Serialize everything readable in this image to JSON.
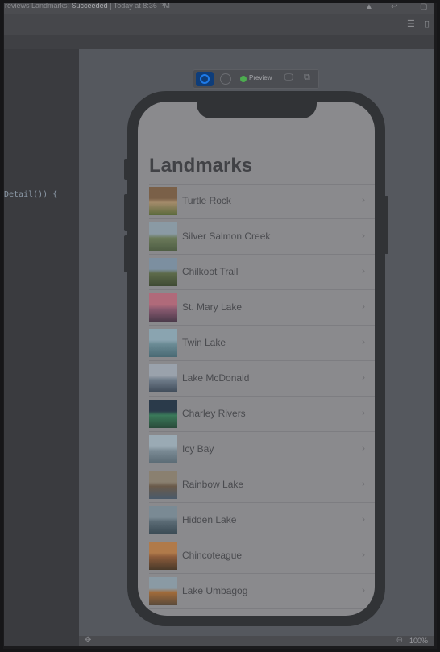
{
  "window": {
    "status_prefix": "reviews Landmarks:",
    "status_result": "Succeeded",
    "status_time": "| Today at 8:36 PM"
  },
  "editor": {
    "code_line": "Detail()) {"
  },
  "preview_toolbar": {
    "preview_label": "Preview"
  },
  "app": {
    "title": "Landmarks",
    "landmarks": [
      {
        "name": "Turtle Rock",
        "colors": [
          "#7a6048",
          "#a38a6a",
          "#5b6a3c"
        ]
      },
      {
        "name": "Silver Salmon Creek",
        "colors": [
          "#8a9aa4",
          "#6b7a5a",
          "#4f5e44"
        ]
      },
      {
        "name": "Chilkoot Trail",
        "colors": [
          "#7c8fa0",
          "#5d6a4a",
          "#3f4b34"
        ]
      },
      {
        "name": "St. Mary Lake",
        "colors": [
          "#b06a7a",
          "#8a5a70",
          "#4b3a4a"
        ]
      },
      {
        "name": "Twin Lake",
        "colors": [
          "#8aa4b0",
          "#6a8a94",
          "#4a6a74"
        ]
      },
      {
        "name": "Lake McDonald",
        "colors": [
          "#9aa2ac",
          "#6f7c8a",
          "#3e4a58"
        ]
      },
      {
        "name": "Charley Rivers",
        "colors": [
          "#2a3a4a",
          "#3a7a5a",
          "#2a4a3a"
        ]
      },
      {
        "name": "Icy Bay",
        "colors": [
          "#9aaab4",
          "#7a8a94",
          "#5a6a74"
        ]
      },
      {
        "name": "Rainbow Lake",
        "colors": [
          "#8a8070",
          "#6a5a4a",
          "#4a5a6a"
        ]
      },
      {
        "name": "Hidden Lake",
        "colors": [
          "#7a8a94",
          "#5a6a74",
          "#3a4a54"
        ]
      },
      {
        "name": "Chincoteague",
        "colors": [
          "#b07a4a",
          "#8a5a3a",
          "#4a3a2a"
        ]
      },
      {
        "name": "Lake Umbagog",
        "colors": [
          "#8a9aa4",
          "#a06a3a",
          "#5a4a3a"
        ]
      }
    ]
  },
  "bottom": {
    "zoom": "100%"
  }
}
